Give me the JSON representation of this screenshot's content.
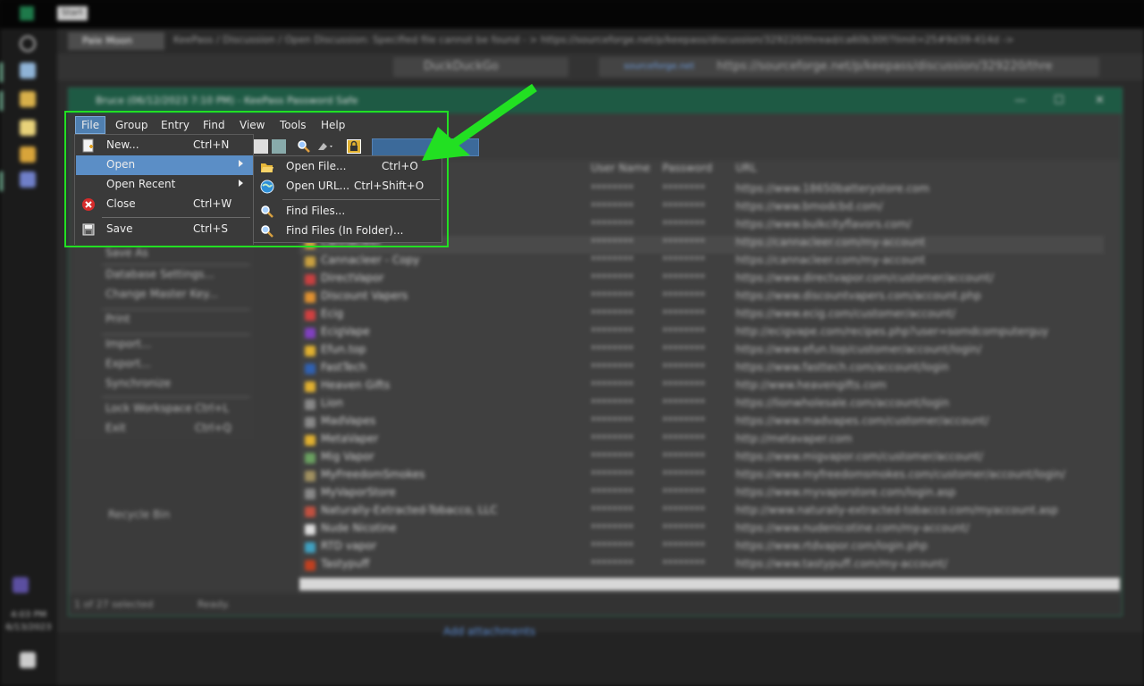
{
  "topbar": {
    "tab_label": "Start"
  },
  "taskbar": {
    "time": "4:03 PM",
    "date": "6/13/2023"
  },
  "browser": {
    "tab_label": "Pale Moon",
    "window_title": "KeePass / Discussion / Open Discussion: Specified file cannot be found - > https://sourceforge.net/p/keepass/discussion/329220/thread/ca60b30f/?limit=25#9d39-414d -> Pale",
    "search_engine": "DuckDuckGo",
    "url_site": "sourceforge.net",
    "url": "https://sourceforge.net/p/keepass/discussion/329220/thre",
    "add_attachments": "Add attachments"
  },
  "keepass": {
    "title": "Bruce (06/12/2023 7:10 PM) - KeePass Password Safe",
    "menubar": [
      "File",
      "Group",
      "Entry",
      "Find",
      "View",
      "Tools",
      "Help"
    ],
    "columns": {
      "user": "User Name",
      "password": "Password",
      "url": "URL"
    },
    "entries": [
      {
        "title": "",
        "user": "********",
        "pw": "********",
        "url": "https://www.18650batterystore.com"
      },
      {
        "title": "",
        "user": "********",
        "pw": "********",
        "url": "https://www.bmodcbd.com/"
      },
      {
        "title": "",
        "user": "********",
        "pw": "********",
        "url": "https://www.bulkcityflavors.com/"
      },
      {
        "title": "Cannacleer",
        "user": "********",
        "pw": "********",
        "url": "https://cannacleer.com/my-account"
      },
      {
        "title": "Cannacleer - Copy",
        "user": "********",
        "pw": "********",
        "url": "https://cannacleer.com/my-account"
      },
      {
        "title": "DirectVapor",
        "user": "********",
        "pw": "********",
        "url": "https://www.directvapor.com/customer/account/"
      },
      {
        "title": "Discount Vapers",
        "user": "********",
        "pw": "********",
        "url": "https://www.discountvapers.com/account.php"
      },
      {
        "title": "Ecig",
        "user": "********",
        "pw": "********",
        "url": "https://www.ecig.com/customer/account/"
      },
      {
        "title": "EcigVape",
        "user": "********",
        "pw": "********",
        "url": "http://ecigvape.com/recipes.php?user=somdcomputerguy"
      },
      {
        "title": "Efun.top",
        "user": "********",
        "pw": "********",
        "url": "https://www.efun.top/customer/account/login/"
      },
      {
        "title": "FastTech",
        "user": "********",
        "pw": "********",
        "url": "https://www.fasttech.com/account/login"
      },
      {
        "title": "Heaven Gifts",
        "user": "********",
        "pw": "********",
        "url": "http://www.heavengifts.com"
      },
      {
        "title": "Lion",
        "user": "********",
        "pw": "********",
        "url": "https://lionwholesale.com/account/login"
      },
      {
        "title": "MadVapes",
        "user": "********",
        "pw": "********",
        "url": "https://www.madvapes.com/customer/account/"
      },
      {
        "title": "MetaVaper",
        "user": "********",
        "pw": "********",
        "url": "http://metavaper.com"
      },
      {
        "title": "Mig Vapor",
        "user": "********",
        "pw": "********",
        "url": "https://www.migvapor.com/customer/account/"
      },
      {
        "title": "MyFreedomSmokes",
        "user": "********",
        "pw": "********",
        "url": "https://www.myfreedomsmokes.com/customer/account/login/"
      },
      {
        "title": "MyVaporStore",
        "user": "********",
        "pw": "********",
        "url": "https://www.myvaporstore.com/login.asp"
      },
      {
        "title": "Naturally-Extracted-Tobacco, LLC",
        "user": "********",
        "pw": "********",
        "url": "http://www.naturally-extracted-tobacco.com/myaccount.asp"
      },
      {
        "title": "Nude Nicotine",
        "user": "********",
        "pw": "********",
        "url": "https://www.nudenicotine.com/my-account/"
      },
      {
        "title": "RTD vapor",
        "user": "********",
        "pw": "********",
        "url": "https://www.rtdvapor.com/login.php"
      },
      {
        "title": "Tastypuff",
        "user": "********",
        "pw": "********",
        "url": "https://www.tastypuff.com/my-account/"
      }
    ],
    "status_selected": "1 of 27 selected",
    "status_ready": "Ready.",
    "tree_item": "Recycle Bin"
  },
  "file_menu": {
    "items": [
      {
        "label": "New...",
        "shortcut": "Ctrl+N"
      },
      {
        "label": "Open",
        "shortcut": ""
      },
      {
        "label": "Open Recent",
        "shortcut": ""
      },
      {
        "label": "Close",
        "shortcut": "Ctrl+W"
      },
      {
        "label": "Save",
        "shortcut": "Ctrl+S"
      }
    ],
    "blurred_items": [
      {
        "label": "Save As",
        "shortcut": ""
      },
      {
        "label": "Database Settings...",
        "shortcut": ""
      },
      {
        "label": "Change Master Key...",
        "shortcut": ""
      },
      {
        "label": "Print",
        "shortcut": ""
      },
      {
        "label": "Import...",
        "shortcut": ""
      },
      {
        "label": "Export...",
        "shortcut": ""
      },
      {
        "label": "Synchronize",
        "shortcut": ""
      },
      {
        "label": "Lock Workspace",
        "shortcut": "Ctrl+L"
      },
      {
        "label": "Exit",
        "shortcut": "Ctrl+Q"
      }
    ]
  },
  "open_submenu": {
    "items": [
      {
        "label": "Open File...",
        "shortcut": "Ctrl+O"
      },
      {
        "label": "Open URL...",
        "shortcut": "Ctrl+Shift+O"
      },
      {
        "label": "Find Files...",
        "shortcut": ""
      },
      {
        "label": "Find Files (In Folder)...",
        "shortcut": ""
      }
    ]
  },
  "colors": {
    "highlight_box": "#22e022",
    "menu_highlight": "#5b8ec6",
    "arrow": "#22e022"
  }
}
